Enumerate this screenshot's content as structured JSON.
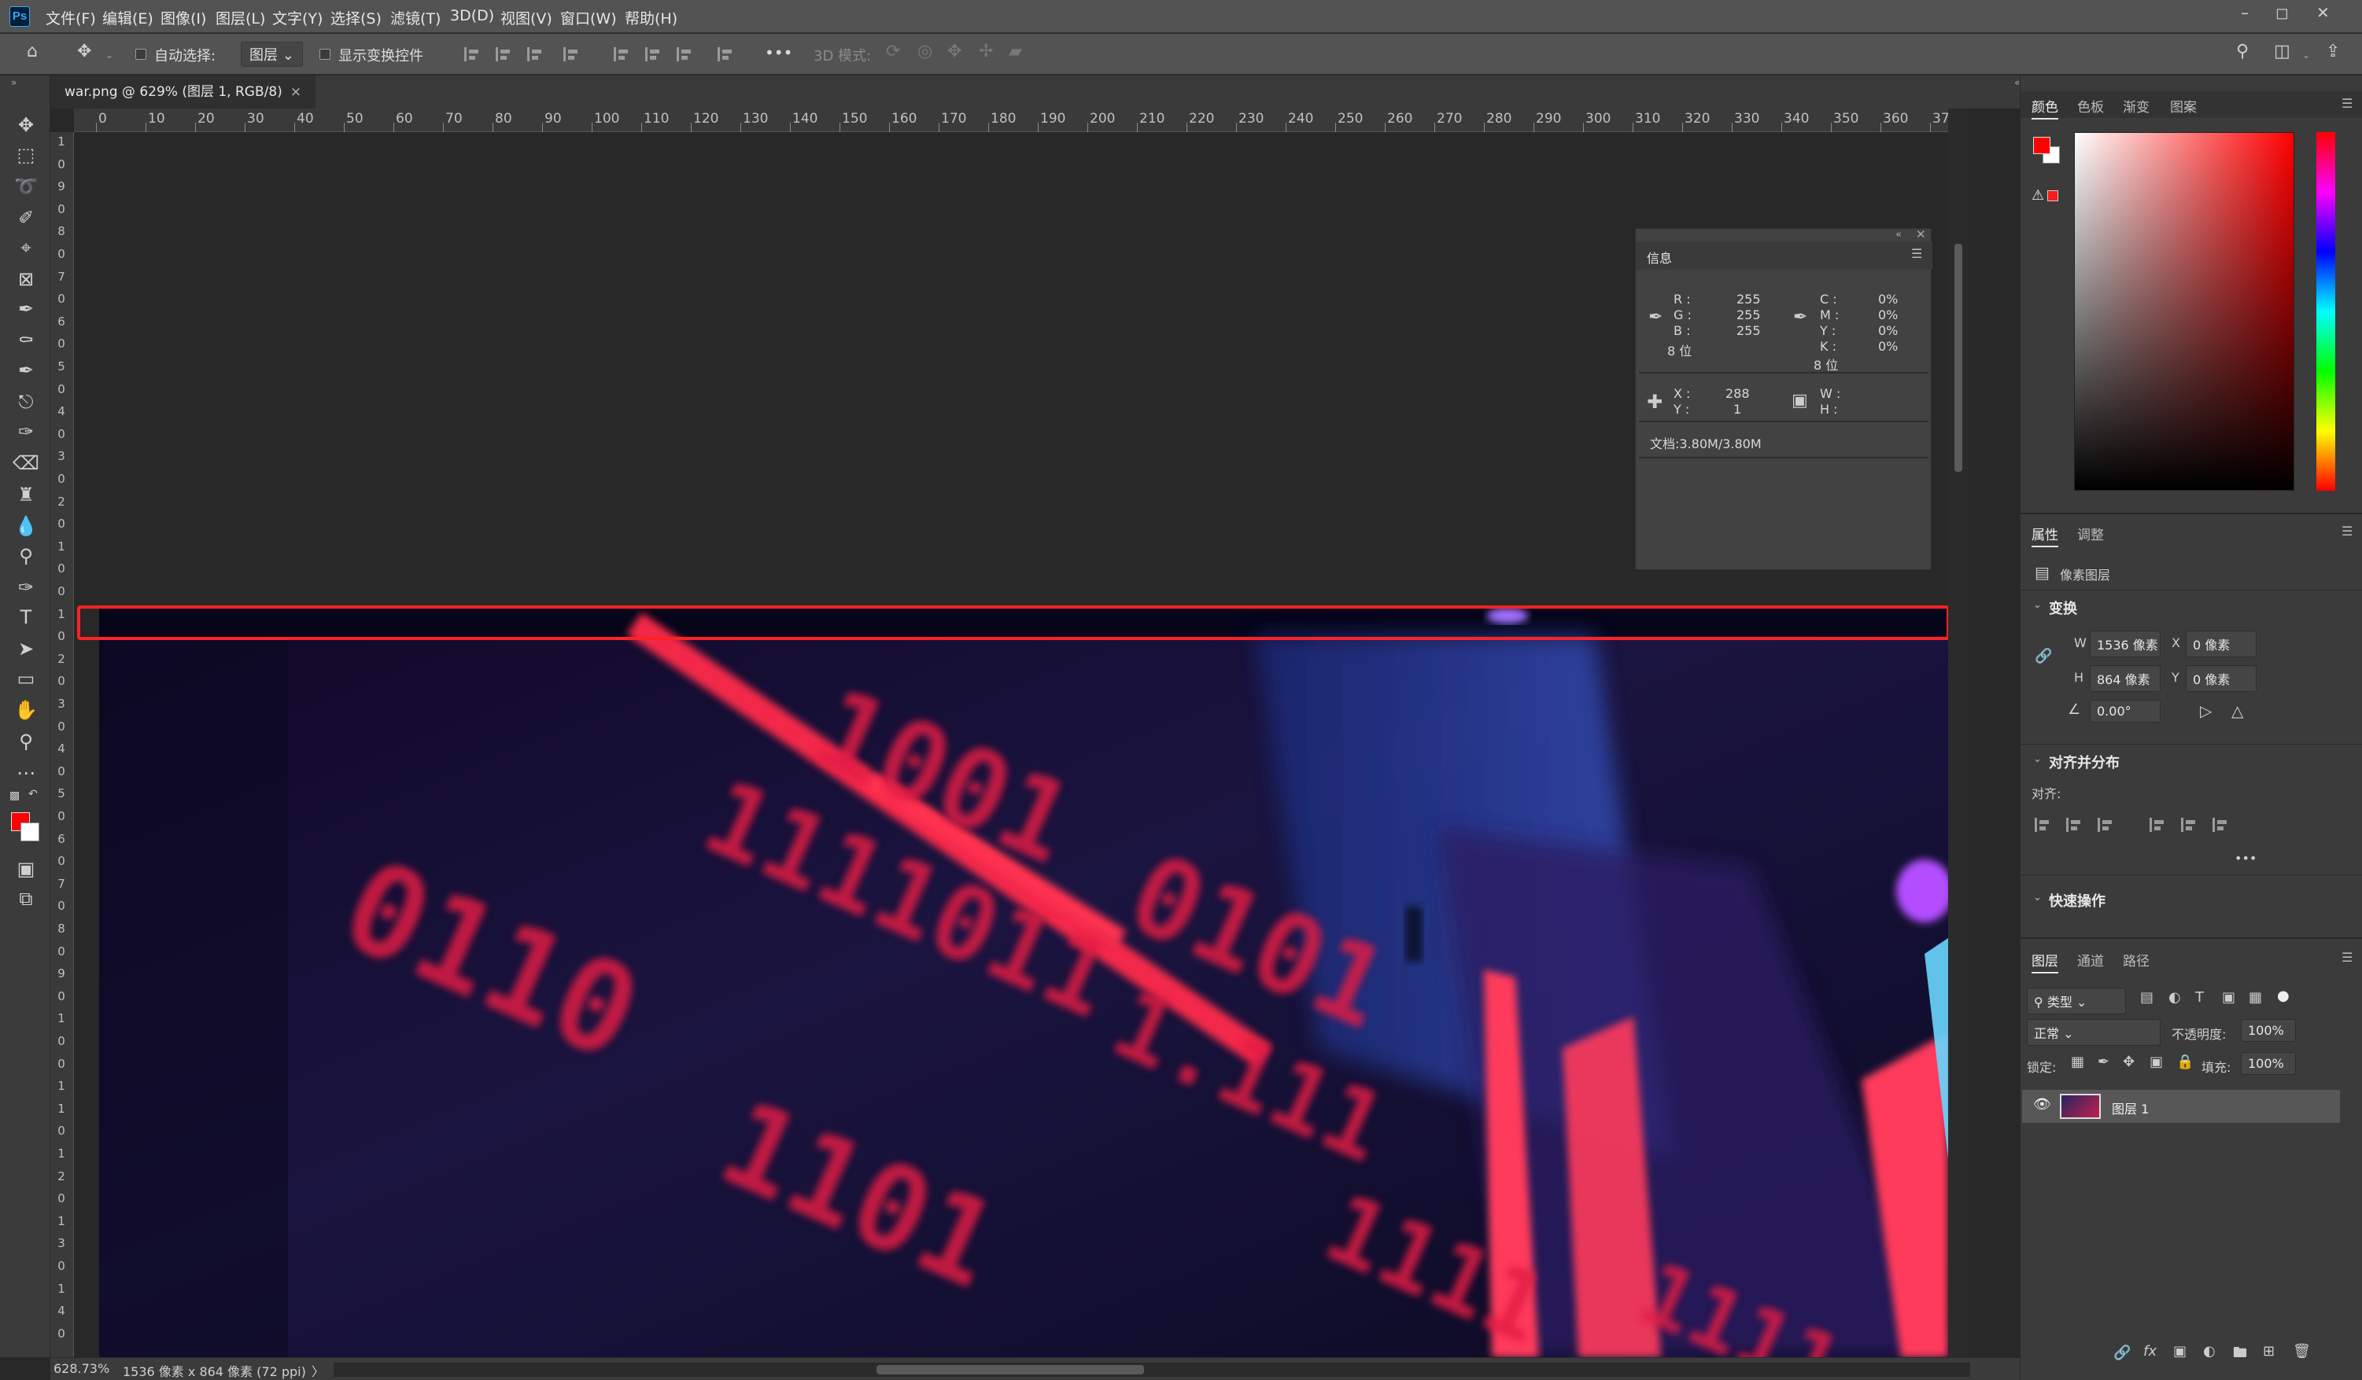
{
  "app": {
    "logo": "Ps",
    "menus": [
      "文件(F)",
      "编辑(E)",
      "图像(I)",
      "图层(L)",
      "文字(Y)",
      "选择(S)",
      "滤镜(T)",
      "3D(D)",
      "视图(V)",
      "窗口(W)",
      "帮助(H)"
    ]
  },
  "options": {
    "auto_select_label": "自动选择:",
    "layer_dropdown": "图层",
    "show_transform_label": "显示变换控件",
    "more": "•••",
    "mode_3d_label": "3D 模式:"
  },
  "document": {
    "tab_title": "war.png @ 629% (图层 1, RGB/8)",
    "tab_close": "×"
  },
  "ruler": {
    "h_ticks": [
      "0",
      "10",
      "20",
      "30",
      "40",
      "50",
      "60",
      "70",
      "80",
      "90",
      "100",
      "110",
      "120",
      "130",
      "140",
      "150",
      "160",
      "170",
      "180",
      "190",
      "200",
      "210",
      "220",
      "230",
      "240",
      "250",
      "260",
      "270",
      "280",
      "290",
      "300",
      "310",
      "320",
      "330",
      "340",
      "350",
      "360",
      "37"
    ],
    "v_ticks": [
      "1",
      "0",
      "9",
      "0",
      "8",
      "0",
      "7",
      "0",
      "6",
      "0",
      "5",
      "0",
      "4",
      "0",
      "3",
      "0",
      "2",
      "0",
      "1",
      "0",
      "0",
      "1",
      "0",
      "2",
      "0",
      "3",
      "0",
      "4",
      "0",
      "5",
      "0",
      "6",
      "0",
      "7",
      "0",
      "8",
      "0",
      "9",
      "0",
      "1",
      "0",
      "0",
      "1",
      "1",
      "0",
      "1",
      "2",
      "0",
      "1",
      "3",
      "0",
      "1",
      "4",
      "0"
    ]
  },
  "info_panel": {
    "title": "信息",
    "rgb": {
      "r_label": "R :",
      "r": "255",
      "g_label": "G :",
      "g": "255",
      "b_label": "B :",
      "b": "255",
      "bits": "8 位"
    },
    "cmyk": {
      "c_label": "C :",
      "c": "0%",
      "m_label": "M :",
      "m": "0%",
      "y_label": "Y :",
      "y": "0%",
      "k_label": "K :",
      "k": "0%",
      "bits": "8 位"
    },
    "xy": {
      "x_label": "X :",
      "x": "288",
      "y_label": "Y :",
      "y": "1"
    },
    "wh": {
      "w_label": "W :",
      "h_label": "H :"
    },
    "doc": "文档:3.80M/3.80M"
  },
  "status": {
    "zoom": "628.73%",
    "size": "1536 像素 x 864 像素 (72 ppi)",
    "arrow": "〉"
  },
  "color_panel": {
    "tabs": [
      "颜色",
      "色板",
      "渐变",
      "图案"
    ],
    "fg": "#ff0000",
    "bg": "#ffffff"
  },
  "properties": {
    "tabs": [
      "属性",
      "调整"
    ],
    "layer_kind": "像素图层",
    "transform_title": "变换",
    "w_label": "W",
    "w": "1536 像素",
    "h_label": "H",
    "h": "864 像素",
    "x_label": "X",
    "x": "0 像素",
    "y_label": "Y",
    "y": "0 像素",
    "angle": "0.00°",
    "align_title": "对齐并分布",
    "align_label": "对齐:",
    "more": "•••",
    "quick_title": "快速操作"
  },
  "layers": {
    "tabs": [
      "图层",
      "通道",
      "路径"
    ],
    "filter": "类型",
    "blend": "正常",
    "opacity_label": "不透明度:",
    "opacity": "100%",
    "lock_label": "锁定:",
    "fill_label": "填充:",
    "fill": "100%",
    "items": [
      {
        "name": "图层 1",
        "visible": true
      }
    ]
  }
}
